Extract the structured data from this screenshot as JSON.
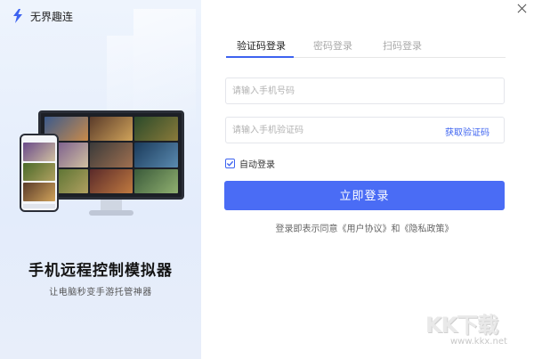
{
  "brand": {
    "name": "无界趣连"
  },
  "promo": {
    "title": "手机远程控制模拟器",
    "subtitle": "让电脑秒变手游托管神器"
  },
  "tabs": [
    {
      "label": "验证码登录",
      "active": true
    },
    {
      "label": "密码登录",
      "active": false
    },
    {
      "label": "扫码登录",
      "active": false
    }
  ],
  "form": {
    "phone_placeholder": "请输入手机号码",
    "code_placeholder": "请输入手机验证码",
    "get_code_label": "获取验证码",
    "auto_login_label": "自动登录",
    "auto_login_checked": true,
    "login_button_label": "立即登录"
  },
  "agreement": {
    "prefix": "登录即表示同意",
    "user_agreement": "《用户协议》",
    "conjunction": "和",
    "privacy_policy": "《隐私政策》"
  },
  "watermark": {
    "logo": "KK下载",
    "url": "www.kkx.net"
  },
  "icons": {
    "close": "close-icon",
    "logo": "brand-logo-icon",
    "check": "check-icon"
  },
  "colors": {
    "accent": "#3d63f0",
    "button": "#4a6cf5",
    "panel": "#eaf1fc"
  }
}
